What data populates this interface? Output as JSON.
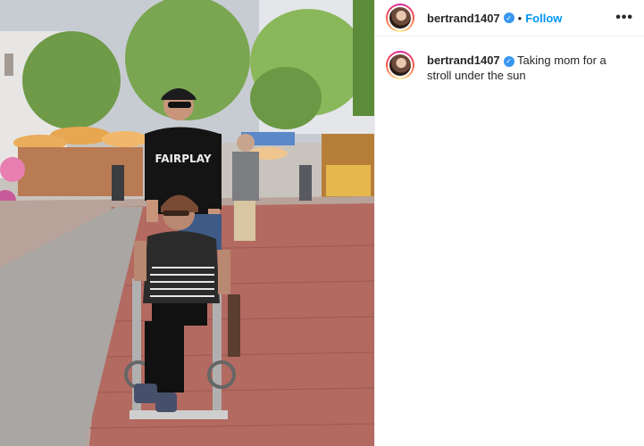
{
  "post": {
    "username": "bertrand1407",
    "follow_label": "Follow",
    "separator": "•",
    "more_label": "•••",
    "verified_mark": "✓",
    "caption": "Taking mom for a stroll under the sun"
  },
  "photo": {
    "shirt_text": "FAIRPLAY"
  },
  "colors": {
    "follow": "#0095f6",
    "verified": "#3897f0",
    "text": "#262626",
    "divider": "#efefef"
  },
  "icons": {
    "verified": "verified-badge-icon",
    "more": "more-options-icon"
  }
}
